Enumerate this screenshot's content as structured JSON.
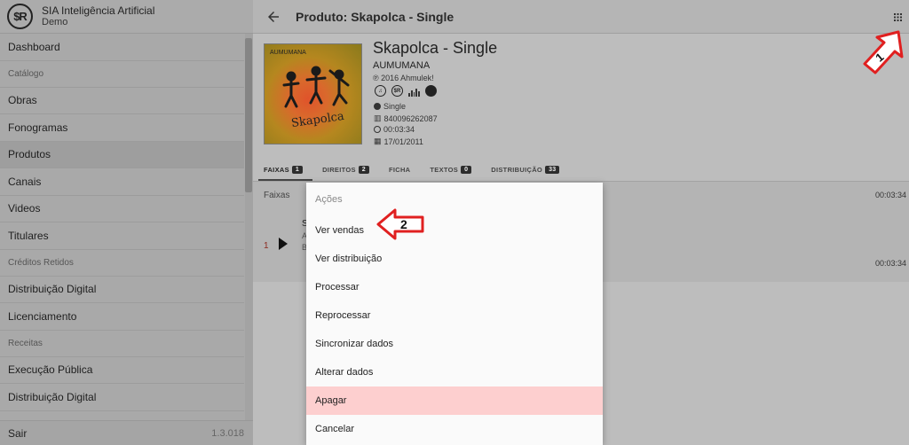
{
  "app": {
    "title": "SIA Inteligência Artificial",
    "subtitle": "Demo",
    "logo_text": "$R"
  },
  "sidebar": {
    "items": [
      {
        "type": "item",
        "label": "Dashboard"
      },
      {
        "type": "section",
        "label": "Catálogo"
      },
      {
        "type": "item",
        "label": "Obras"
      },
      {
        "type": "item",
        "label": "Fonogramas"
      },
      {
        "type": "item",
        "label": "Produtos",
        "active": true
      },
      {
        "type": "item",
        "label": "Canais"
      },
      {
        "type": "item",
        "label": "Videos"
      },
      {
        "type": "item",
        "label": "Titulares"
      },
      {
        "type": "section",
        "label": "Créditos Retidos"
      },
      {
        "type": "item",
        "label": "Distribuição Digital"
      },
      {
        "type": "item",
        "label": "Licenciamento"
      },
      {
        "type": "section",
        "label": "Receitas"
      },
      {
        "type": "item",
        "label": "Execução Pública"
      },
      {
        "type": "item",
        "label": "Distribuição Digital"
      }
    ],
    "footer": {
      "logout": "Sair",
      "version": "1.3.018"
    }
  },
  "topbar": {
    "title": "Produto: Skapolca - Single"
  },
  "product": {
    "cover_text": "Skapolca",
    "cover_small": "AUMUMANA",
    "name": "Skapolca - Single",
    "artist": "AUMUMANA",
    "copyright": "℗ 2016 Ahmulek!",
    "type": "Single",
    "barcode": "840096262087",
    "duration": "00:03:34",
    "date": "17/01/2011"
  },
  "tabs": [
    {
      "label": "FAIXAS",
      "badge": "1",
      "active": true
    },
    {
      "label": "DIREITOS",
      "badge": "2"
    },
    {
      "label": "FICHA",
      "badge": ""
    },
    {
      "label": "TEXTOS",
      "badge": "0"
    },
    {
      "label": "DISTRIBUIÇÃO",
      "badge": "33"
    }
  ],
  "tracks": {
    "header": "Faixas",
    "header_duration": "00:03:34",
    "track": {
      "number": "1",
      "title": "S",
      "line2": "A",
      "line3": "B",
      "duration": "00:03:34"
    }
  },
  "menu": {
    "header": "Ações",
    "items": [
      "Ver vendas",
      "Ver distribuição",
      "Processar",
      "Reprocessar",
      "Sincronizar dados",
      "Alterar dados",
      "Apagar",
      "Cancelar"
    ]
  },
  "annotations": {
    "arrow1": "1",
    "arrow2": "2"
  },
  "colors": {
    "danger_bg": "#fdcfcf",
    "annotation_red": "#e02020"
  }
}
